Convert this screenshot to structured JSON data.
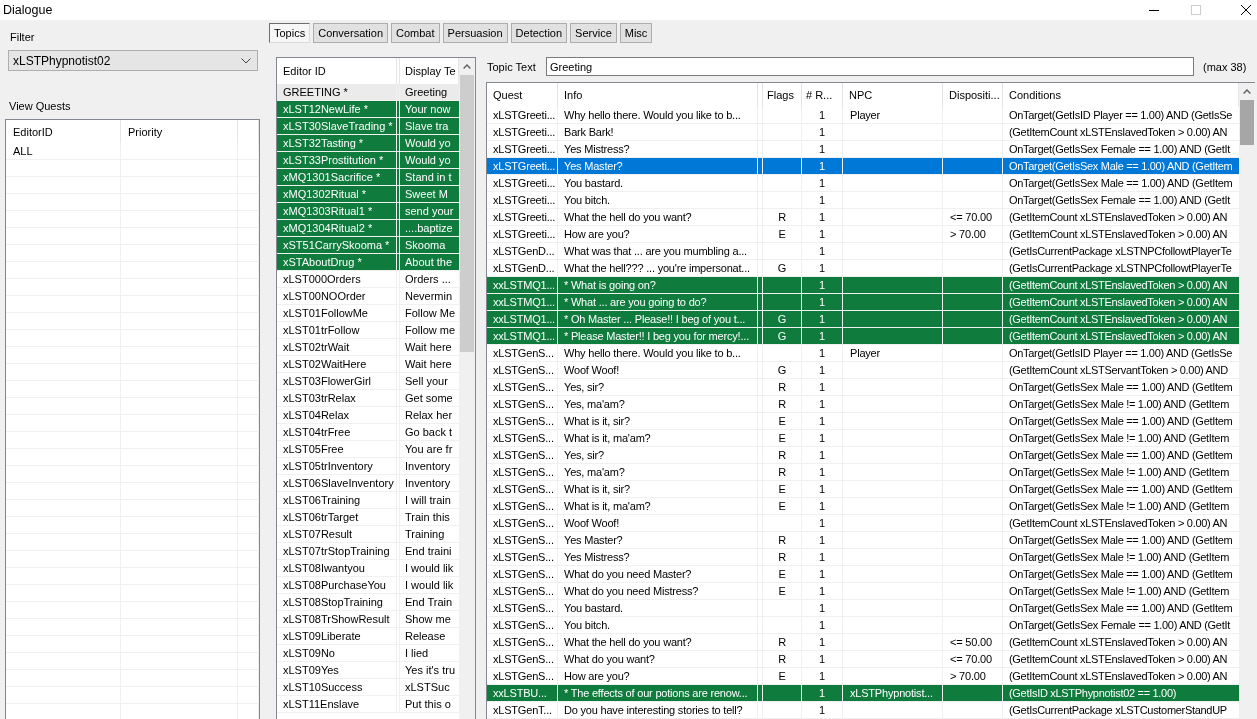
{
  "window": {
    "title": "Dialogue",
    "maximize_disabled": true
  },
  "filter": {
    "label": "Filter",
    "value": "xLSTPhypnotist02"
  },
  "quests": {
    "label": "View Quests",
    "columns": [
      "EditorID",
      "Priority"
    ],
    "rows": [
      {
        "editor_id": "ALL"
      }
    ]
  },
  "tabs": [
    {
      "label": "Topics",
      "selected": true
    },
    {
      "label": "Conversation",
      "selected": false
    },
    {
      "label": "Combat",
      "selected": false
    },
    {
      "label": "Persuasion",
      "selected": false
    },
    {
      "label": "Detection",
      "selected": false
    },
    {
      "label": "Service",
      "selected": false
    },
    {
      "label": "Misc",
      "selected": false
    }
  ],
  "topics": {
    "columns": [
      "Editor ID",
      "Display Te"
    ],
    "rows": [
      {
        "editor_id": "GREETING *",
        "display_text": "Greeting",
        "selected": true,
        "highlighted": false
      },
      {
        "editor_id": "xLST12NewLife *",
        "display_text": "Your now",
        "selected": false,
        "highlighted": true
      },
      {
        "editor_id": "xLST30SlaveTrading *",
        "display_text": "Slave tra",
        "selected": false,
        "highlighted": true
      },
      {
        "editor_id": "xLST32Tasting *",
        "display_text": "Would yo",
        "selected": false,
        "highlighted": true
      },
      {
        "editor_id": "xLST33Prostitution *",
        "display_text": "Would yo",
        "selected": false,
        "highlighted": true
      },
      {
        "editor_id": "xMQ1301Sacrifice *",
        "display_text": "Stand in t",
        "selected": false,
        "highlighted": true
      },
      {
        "editor_id": "xMQ1302Ritual *",
        "display_text": "Sweet M",
        "selected": false,
        "highlighted": true
      },
      {
        "editor_id": "xMQ1303Ritual1 *",
        "display_text": "send your",
        "selected": false,
        "highlighted": true
      },
      {
        "editor_id": "xMQ1304Ritual2 *",
        "display_text": "....baptize",
        "selected": false,
        "highlighted": true
      },
      {
        "editor_id": "xST51CarrySkooma *",
        "display_text": "Skooma",
        "selected": false,
        "highlighted": true
      },
      {
        "editor_id": "xSTAboutDrug *",
        "display_text": "About the",
        "selected": false,
        "highlighted": true
      },
      {
        "editor_id": "xLST000Orders",
        "display_text": "Orders ...",
        "selected": false,
        "highlighted": false
      },
      {
        "editor_id": "xLST00NOOrder",
        "display_text": "Nevermin",
        "selected": false,
        "highlighted": false
      },
      {
        "editor_id": "xLST01FollowMe",
        "display_text": "Follow Me",
        "selected": false,
        "highlighted": false
      },
      {
        "editor_id": "xLST01trFollow",
        "display_text": "Follow me",
        "selected": false,
        "highlighted": false
      },
      {
        "editor_id": "xLST02trWait",
        "display_text": "Wait here",
        "selected": false,
        "highlighted": false
      },
      {
        "editor_id": "xLST02WaitHere",
        "display_text": "Wait here",
        "selected": false,
        "highlighted": false
      },
      {
        "editor_id": "xLST03FlowerGirl",
        "display_text": "Sell your",
        "selected": false,
        "highlighted": false
      },
      {
        "editor_id": "xLST03trRelax",
        "display_text": "Get some",
        "selected": false,
        "highlighted": false
      },
      {
        "editor_id": "xLST04Relax",
        "display_text": "Relax her",
        "selected": false,
        "highlighted": false
      },
      {
        "editor_id": "xLST04trFree",
        "display_text": "Go back t",
        "selected": false,
        "highlighted": false
      },
      {
        "editor_id": "xLST05Free",
        "display_text": "You are fr",
        "selected": false,
        "highlighted": false
      },
      {
        "editor_id": "xLST05trInventory",
        "display_text": "Inventory",
        "selected": false,
        "highlighted": false
      },
      {
        "editor_id": "xLST06SlaveInventory",
        "display_text": "Inventory",
        "selected": false,
        "highlighted": false
      },
      {
        "editor_id": "xLST06Training",
        "display_text": "I will train",
        "selected": false,
        "highlighted": false
      },
      {
        "editor_id": "xLST06trTarget",
        "display_text": "Train this",
        "selected": false,
        "highlighted": false
      },
      {
        "editor_id": "xLST07Result",
        "display_text": "Training",
        "selected": false,
        "highlighted": false
      },
      {
        "editor_id": "xLST07trStopTraining",
        "display_text": "End traini",
        "selected": false,
        "highlighted": false
      },
      {
        "editor_id": "xLST08Iwantyou",
        "display_text": "I would lik",
        "selected": false,
        "highlighted": false
      },
      {
        "editor_id": "xLST08PurchaseYou",
        "display_text": "I would lik",
        "selected": false,
        "highlighted": false
      },
      {
        "editor_id": "xLST08StopTraining",
        "display_text": "End Train",
        "selected": false,
        "highlighted": false
      },
      {
        "editor_id": "xLST08TrShowResult",
        "display_text": "Show me",
        "selected": false,
        "highlighted": false
      },
      {
        "editor_id": "xLST09Liberate",
        "display_text": "Release",
        "selected": false,
        "highlighted": false
      },
      {
        "editor_id": "xLST09No",
        "display_text": "I lied",
        "selected": false,
        "highlighted": false
      },
      {
        "editor_id": "xLST09Yes",
        "display_text": "Yes it's tru",
        "selected": false,
        "highlighted": false
      },
      {
        "editor_id": "xLST10Success",
        "display_text": "xLSTSuc",
        "selected": false,
        "highlighted": false
      },
      {
        "editor_id": "xLST11Enslave",
        "display_text": "Put this o",
        "selected": false,
        "highlighted": false
      }
    ]
  },
  "topic_text": {
    "label": "Topic Text",
    "value": "Greeting",
    "hint": "(max 38)"
  },
  "infos": {
    "columns": [
      "Quest",
      "Info",
      "Flags",
      "# R...",
      "NPC",
      "Dispositi...",
      "Conditions"
    ],
    "rows": [
      {
        "quest": "xLSTGreeti...",
        "info": "Why hello there.  Would you like to b...",
        "column_4": "1",
        "npc": "Player",
        "conditions": "OnTarget(GetIsID Player == 1.00) AND (GetIsSe",
        "selected": false,
        "highlighted": false
      },
      {
        "quest": "xLSTGreeti...",
        "info": "Bark Bark!",
        "column_4": "1",
        "conditions": "(GetItemCount xLSTEnslavedToken > 0.00) AN",
        "selected": false,
        "highlighted": false
      },
      {
        "quest": "xLSTGreeti...",
        "info": "Yes Mistress?",
        "column_4": "1",
        "conditions": "OnTarget(GetIsSex Female == 1.00) AND (GetIt",
        "selected": false,
        "highlighted": false
      },
      {
        "quest": "xLSTGreeti...",
        "info": "Yes Master?",
        "column_4": "1",
        "conditions": "OnTarget(GetIsSex Male == 1.00) AND (GetItem",
        "selected": true,
        "highlighted": false
      },
      {
        "quest": "xLSTGreeti...",
        "info": "You bastard.",
        "column_4": "1",
        "conditions": "OnTarget(GetIsSex Male == 1.00) AND (GetItem",
        "selected": false,
        "highlighted": false
      },
      {
        "quest": "xLSTGreeti...",
        "info": "You bitch.",
        "column_4": "1",
        "conditions": "OnTarget(GetIsSex Female == 1.00) AND (GetIt",
        "selected": false,
        "highlighted": false
      },
      {
        "quest": "xLSTGreeti...",
        "info": "What the hell do you want?",
        "flags": "R",
        "column_4": "1",
        "disposition": "<= 70.00",
        "conditions": "(GetItemCount xLSTEnslavedToken > 0.00) AN",
        "selected": false,
        "highlighted": false
      },
      {
        "quest": "xLSTGreeti...",
        "info": "How are you?",
        "flags": "E",
        "column_4": "1",
        "disposition": "> 70.00",
        "conditions": "(GetItemCount xLSTEnslavedToken > 0.00) AN",
        "selected": false,
        "highlighted": false
      },
      {
        "quest": "xLSTGenD...",
        "info": "What was that ... are you mumbling a...",
        "column_4": "1",
        "conditions": "(GetIsCurrentPackage xLSTNPCfollowtPlayerTe",
        "selected": false,
        "highlighted": false
      },
      {
        "quest": "xLSTGenD...",
        "info": "What the hell??? ... you're impersonat...",
        "flags": "G",
        "column_4": "1",
        "conditions": "(GetIsCurrentPackage xLSTNPCfollowtPlayerTe",
        "selected": false,
        "highlighted": false
      },
      {
        "quest": "xxLSTMQ1...",
        "info": "* What is going on?",
        "column_4": "1",
        "conditions": "(GetItemCount xLSTEnslavedToken > 0.00) AN",
        "selected": false,
        "highlighted": true
      },
      {
        "quest": "xxLSTMQ1...",
        "info": "* What ... are you going to do?",
        "column_4": "1",
        "conditions": "(GetItemCount xLSTEnslavedToken > 0.00) AN",
        "selected": false,
        "highlighted": true
      },
      {
        "quest": "xxLSTMQ1...",
        "info": "* Oh Master ... Please!!  I beg of you t...",
        "flags": "G",
        "column_4": "1",
        "conditions": "(GetItemCount xLSTEnslavedToken > 0.00) AN",
        "selected": false,
        "highlighted": true
      },
      {
        "quest": "xxLSTMQ1...",
        "info": "* Please Master!!  I beg you for mercy!...",
        "flags": "G",
        "column_4": "1",
        "conditions": "(GetItemCount xLSTEnslavedToken > 0.00) AN",
        "selected": false,
        "highlighted": true
      },
      {
        "quest": "xLSTGenS...",
        "info": "Why hello there.  Would you like to b...",
        "column_4": "1",
        "npc": "Player",
        "conditions": "OnTarget(GetIsID Player == 1.00) AND (GetIsSe",
        "selected": false,
        "highlighted": false
      },
      {
        "quest": "xLSTGenS...",
        "info": "Woof Woof!",
        "flags": "G",
        "column_4": "1",
        "conditions": "(GetItemCount xLSTServantToken > 0.00) AND",
        "selected": false,
        "highlighted": false
      },
      {
        "quest": "xLSTGenS...",
        "info": "Yes, sir?",
        "flags": "R",
        "column_4": "1",
        "conditions": "OnTarget(GetIsSex Male == 1.00) AND (GetItem",
        "selected": false,
        "highlighted": false
      },
      {
        "quest": "xLSTGenS...",
        "info": "Yes, ma'am?",
        "flags": "R",
        "column_4": "1",
        "conditions": "OnTarget(GetIsSex Male != 1.00) AND (GetItem",
        "selected": false,
        "highlighted": false
      },
      {
        "quest": "xLSTGenS...",
        "info": "What is it, sir?",
        "flags": "E",
        "column_4": "1",
        "conditions": "OnTarget(GetIsSex Male == 1.00) AND (GetItem",
        "selected": false,
        "highlighted": false
      },
      {
        "quest": "xLSTGenS...",
        "info": "What is it, ma'am?",
        "flags": "E",
        "column_4": "1",
        "conditions": "OnTarget(GetIsSex Male != 1.00) AND (GetItem",
        "selected": false,
        "highlighted": false
      },
      {
        "quest": "xLSTGenS...",
        "info": "Yes, sir?",
        "flags": "R",
        "column_4": "1",
        "conditions": "OnTarget(GetIsSex Male == 1.00) AND (GetItem",
        "selected": false,
        "highlighted": false
      },
      {
        "quest": "xLSTGenS...",
        "info": "Yes, ma'am?",
        "flags": "R",
        "column_4": "1",
        "conditions": "OnTarget(GetIsSex Male != 1.00) AND (GetItem",
        "selected": false,
        "highlighted": false
      },
      {
        "quest": "xLSTGenS...",
        "info": "What is it, sir?",
        "flags": "E",
        "column_4": "1",
        "conditions": "OnTarget(GetIsSex Male == 1.00) AND (GetItem",
        "selected": false,
        "highlighted": false
      },
      {
        "quest": "xLSTGenS...",
        "info": "What is it, ma'am?",
        "flags": "E",
        "column_4": "1",
        "conditions": "OnTarget(GetIsSex Male != 1.00) AND (GetItem",
        "selected": false,
        "highlighted": false
      },
      {
        "quest": "xLSTGenS...",
        "info": "Woof Woof!",
        "column_4": "1",
        "conditions": "(GetItemCount xLSTEnslavedToken > 0.00) AN",
        "selected": false,
        "highlighted": false
      },
      {
        "quest": "xLSTGenS...",
        "info": "Yes Master?",
        "flags": "R",
        "column_4": "1",
        "conditions": "OnTarget(GetIsSex Male == 1.00) AND (GetItem",
        "selected": false,
        "highlighted": false
      },
      {
        "quest": "xLSTGenS...",
        "info": "Yes Mistress?",
        "flags": "R",
        "column_4": "1",
        "conditions": "OnTarget(GetIsSex Male != 1.00) AND (GetItem",
        "selected": false,
        "highlighted": false
      },
      {
        "quest": "xLSTGenS...",
        "info": "What do you need Master?",
        "flags": "E",
        "column_4": "1",
        "conditions": "OnTarget(GetIsSex Male == 1.00) AND (GetItem",
        "selected": false,
        "highlighted": false
      },
      {
        "quest": "xLSTGenS...",
        "info": "What do you need Mistress?",
        "flags": "E",
        "column_4": "1",
        "conditions": "OnTarget(GetIsSex Male != 1.00) AND (GetItem",
        "selected": false,
        "highlighted": false
      },
      {
        "quest": "xLSTGenS...",
        "info": "You bastard.",
        "column_4": "1",
        "conditions": "OnTarget(GetIsSex Male == 1.00) AND (GetItem",
        "selected": false,
        "highlighted": false
      },
      {
        "quest": "xLSTGenS...",
        "info": "You bitch.",
        "column_4": "1",
        "conditions": "OnTarget(GetIsSex Female == 1.00) AND (GetIt",
        "selected": false,
        "highlighted": false
      },
      {
        "quest": "xLSTGenS...",
        "info": "What the hell do you want?",
        "flags": "R",
        "column_4": "1",
        "disposition": "<= 50.00",
        "conditions": "(GetItemCount xLSTEnslavedToken > 0.00) AN",
        "selected": false,
        "highlighted": false
      },
      {
        "quest": "xLSTGenS...",
        "info": "What do you want?",
        "flags": "R",
        "column_4": "1",
        "disposition": "<= 70.00",
        "conditions": "(GetItemCount xLSTEnslavedToken > 0.00) AN",
        "selected": false,
        "highlighted": false
      },
      {
        "quest": "xLSTGenS...",
        "info": "How are you?",
        "flags": "E",
        "column_4": "1",
        "disposition": "> 70.00",
        "conditions": "(GetItemCount xLSTEnslavedToken > 0.00) AN",
        "selected": false,
        "highlighted": false
      },
      {
        "quest": "xxLSTBU...",
        "info": "* The effects of our potions are renow...",
        "column_4": "1",
        "npc": "xLSTPhypnotist...",
        "conditions": "(GetIsID xLSTPhypnotist02 == 1.00)",
        "selected": false,
        "highlighted": true
      },
      {
        "quest": "xLSTGenT...",
        "info": "Do you have interesting stories to tell?",
        "column_4": "1",
        "conditions": "(GetIsCurrentPackage xLSTCustomerStandUP",
        "selected": false,
        "highlighted": false
      }
    ]
  }
}
